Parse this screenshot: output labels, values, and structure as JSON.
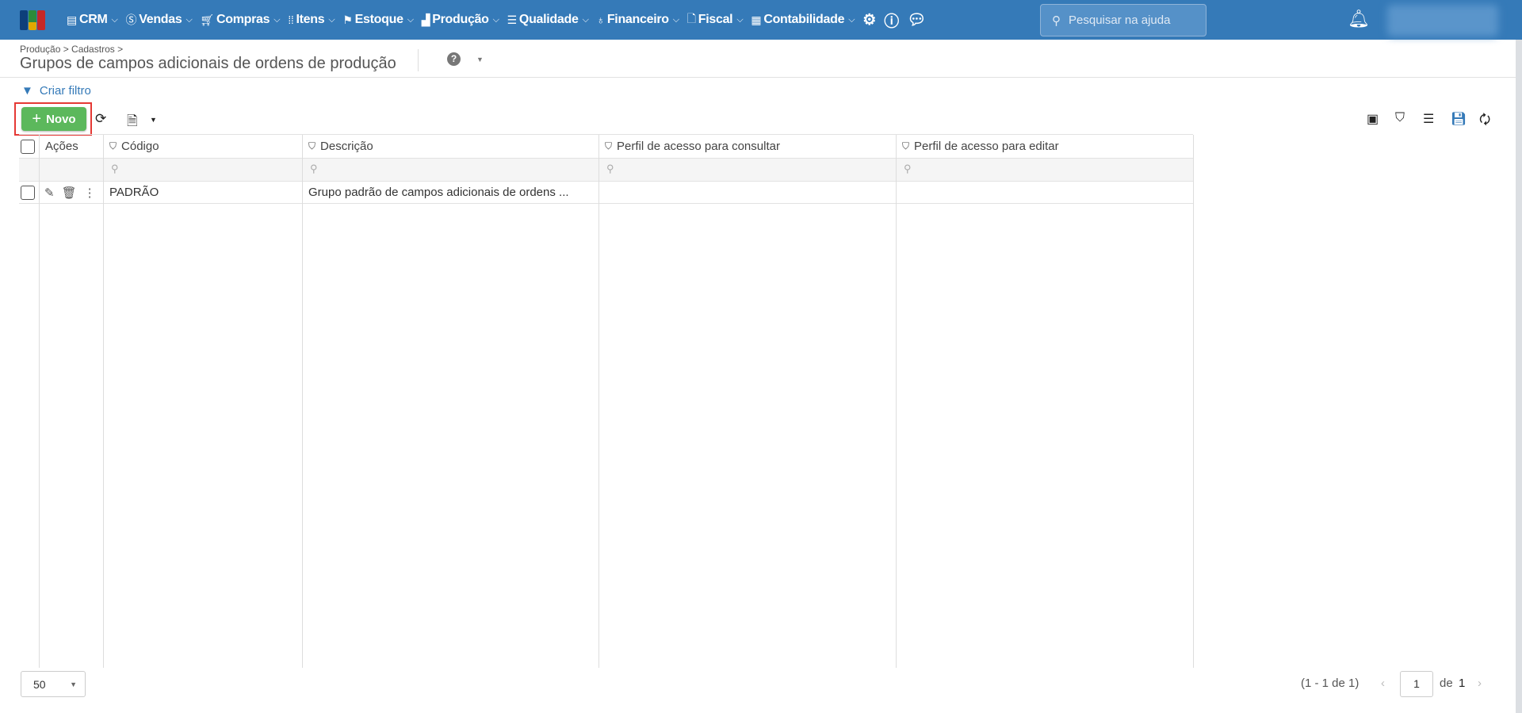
{
  "colors": {
    "header": "#357ab8",
    "accent": "#357ab8",
    "new_button": "#5cb85c",
    "highlight_frame": "#e53935"
  },
  "nav": {
    "items": [
      {
        "label": "CRM",
        "icon": "crm-icon"
      },
      {
        "label": "Vendas",
        "icon": "dollar-icon"
      },
      {
        "label": "Compras",
        "icon": "cart-icon"
      },
      {
        "label": "Itens",
        "icon": "items-icon"
      },
      {
        "label": "Estoque",
        "icon": "stock-icon"
      },
      {
        "label": "Produção",
        "icon": "factory-icon"
      },
      {
        "label": "Qualidade",
        "icon": "checklist-icon"
      },
      {
        "label": "Financeiro",
        "icon": "money-bag-icon"
      },
      {
        "label": "Fiscal",
        "icon": "document-check-icon"
      },
      {
        "label": "Contabilidade",
        "icon": "calculator-icon"
      }
    ]
  },
  "search": {
    "placeholder": "Pesquisar na ajuda"
  },
  "breadcrumb": "Produção > Cadastros >",
  "page_title": "Grupos de campos adicionais de ordens de produção",
  "toolbar": {
    "create_filter": "Criar filtro",
    "new_label": "Novo"
  },
  "table": {
    "columns": [
      "Ações",
      "Código",
      "Descrição",
      "Perfil de acesso para consultar",
      "Perfil de acesso para editar"
    ],
    "rows": [
      {
        "codigo": "PADRÃO",
        "descricao": "Grupo padrão de campos adicionais de ordens ...",
        "consultar": "",
        "editar": ""
      }
    ]
  },
  "footer": {
    "page_size": "50",
    "range": "(1 - 1 de 1)",
    "page": "1",
    "of_label": "de",
    "total_pages": "1"
  }
}
